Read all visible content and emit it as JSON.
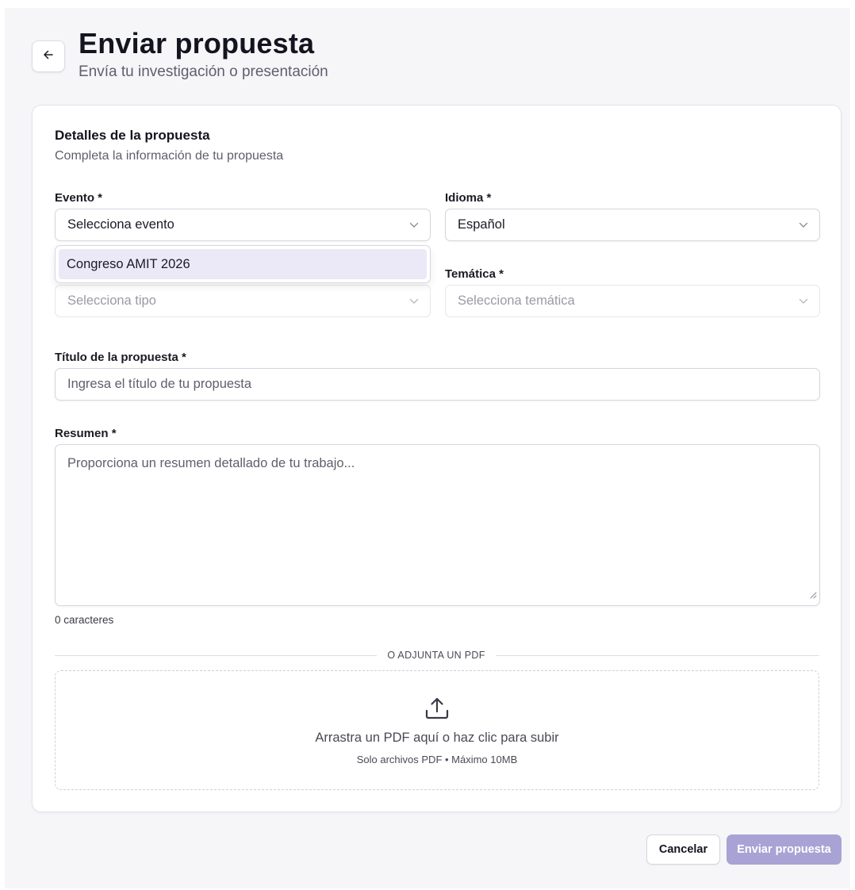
{
  "header": {
    "back_icon": "arrow-left-icon",
    "title": "Enviar propuesta",
    "subtitle": "Envía tu investigación o presentación"
  },
  "card": {
    "title": "Detalles de la propuesta",
    "subtitle": "Completa la información de tu propuesta"
  },
  "form": {
    "evento": {
      "label": "Evento *",
      "value": "Selecciona evento",
      "open": true,
      "options": [
        "Congreso AMIT 2026"
      ]
    },
    "idioma": {
      "label": "Idioma *",
      "value": "Español"
    },
    "tipo": {
      "value": "Selecciona tipo",
      "disabled": true
    },
    "tematica": {
      "label": "Temática *",
      "value": "Selecciona temática",
      "disabled": true
    },
    "titulo": {
      "label": "Título de la propuesta *",
      "placeholder": "Ingresa el título de tu propuesta"
    },
    "resumen": {
      "label": "Resumen *",
      "placeholder": "Proporciona un resumen detallado de tu trabajo...",
      "char_count": "0 caracteres"
    },
    "divider_text": "O ADJUNTA UN PDF",
    "upload": {
      "icon": "upload-icon",
      "main_text": "Arrastra un PDF aquí o haz clic para subir",
      "sub_text": "Solo archivos PDF • Máximo 10MB"
    }
  },
  "actions": {
    "cancel_label": "Cancelar",
    "submit_label": "Enviar propuesta",
    "submit_color": "#a8a3d4"
  }
}
